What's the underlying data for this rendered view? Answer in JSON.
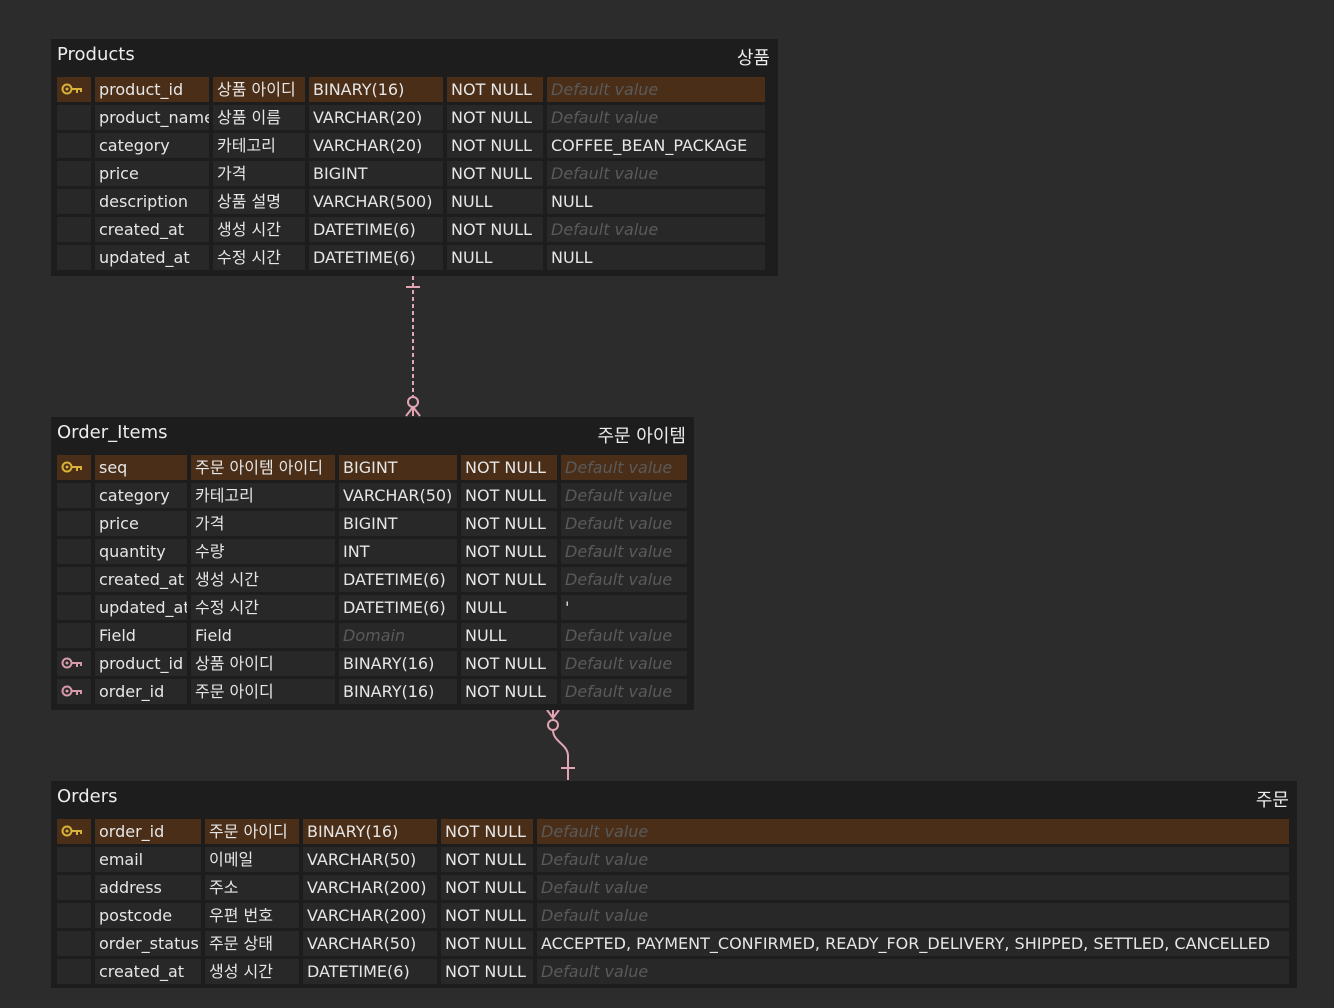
{
  "colors": {
    "background": "#2c2c2c",
    "table_bg": "#1d1d1d",
    "cell_bg": "#282828",
    "pk_row_bg": "#4a2e18",
    "pk_key": "#d9b23a",
    "fk_key": "#d89aa8",
    "relation_line": "#e3a5b4"
  },
  "placeholders": {
    "default_value": "Default value",
    "domain": "Domain"
  },
  "tables": {
    "products": {
      "title": "Products",
      "korean_name": "상품",
      "rows": [
        {
          "key": "pk",
          "name": "product_id",
          "comment": "상품 아이디",
          "type": "BINARY(16)",
          "nullable": "NOT NULL",
          "default": ""
        },
        {
          "key": "",
          "name": "product_name",
          "comment": "상품 이름",
          "type": "VARCHAR(20)",
          "nullable": "NOT NULL",
          "default": ""
        },
        {
          "key": "",
          "name": "category",
          "comment": "카테고리",
          "type": "VARCHAR(20)",
          "nullable": "NOT NULL",
          "default": "COFFEE_BEAN_PACKAGE"
        },
        {
          "key": "",
          "name": "price",
          "comment": "가격",
          "type": "BIGINT",
          "nullable": "NOT NULL",
          "default": ""
        },
        {
          "key": "",
          "name": "description",
          "comment": "상품 설명",
          "type": "VARCHAR(500)",
          "nullable": "NULL",
          "default": "NULL"
        },
        {
          "key": "",
          "name": "created_at",
          "comment": "생성 시간",
          "type": "DATETIME(6)",
          "nullable": "NOT NULL",
          "default": ""
        },
        {
          "key": "",
          "name": "updated_at",
          "comment": "수정 시간",
          "type": "DATETIME(6)",
          "nullable": "NULL",
          "default": "NULL"
        }
      ]
    },
    "order_items": {
      "title": "Order_Items",
      "korean_name": "주문 아이템",
      "rows": [
        {
          "key": "pk",
          "name": "seq",
          "comment": "주문 아이템 아이디",
          "type": "BIGINT",
          "nullable": "NOT NULL",
          "default": ""
        },
        {
          "key": "",
          "name": "category",
          "comment": "카테고리",
          "type": "VARCHAR(50)",
          "nullable": "NOT NULL",
          "default": ""
        },
        {
          "key": "",
          "name": "price",
          "comment": "가격",
          "type": "BIGINT",
          "nullable": "NOT NULL",
          "default": ""
        },
        {
          "key": "",
          "name": "quantity",
          "comment": "수량",
          "type": "INT",
          "nullable": "NOT NULL",
          "default": ""
        },
        {
          "key": "",
          "name": "created_at",
          "comment": "생성 시간",
          "type": "DATETIME(6)",
          "nullable": "NOT NULL",
          "default": ""
        },
        {
          "key": "",
          "name": "updated_at",
          "comment": "수정 시간",
          "type": "DATETIME(6)",
          "nullable": "NULL",
          "default": "'"
        },
        {
          "key": "",
          "name": "Field",
          "comment": "Field",
          "type": "",
          "nullable": "NULL",
          "default": ""
        },
        {
          "key": "fk",
          "name": "product_id",
          "comment": "상품 아이디",
          "type": "BINARY(16)",
          "nullable": "NOT NULL",
          "default": ""
        },
        {
          "key": "fk",
          "name": "order_id",
          "comment": "주문 아이디",
          "type": "BINARY(16)",
          "nullable": "NOT NULL",
          "default": ""
        }
      ]
    },
    "orders": {
      "title": "Orders",
      "korean_name": "주문",
      "rows": [
        {
          "key": "pk",
          "name": "order_id",
          "comment": "주문 아이디",
          "type": "BINARY(16)",
          "nullable": "NOT NULL",
          "default": ""
        },
        {
          "key": "",
          "name": "email",
          "comment": "이메일",
          "type": "VARCHAR(50)",
          "nullable": "NOT NULL",
          "default": ""
        },
        {
          "key": "",
          "name": "address",
          "comment": "주소",
          "type": "VARCHAR(200)",
          "nullable": "NOT NULL",
          "default": ""
        },
        {
          "key": "",
          "name": "postcode",
          "comment": "우편 번호",
          "type": "VARCHAR(200)",
          "nullable": "NOT NULL",
          "default": ""
        },
        {
          "key": "",
          "name": "order_status",
          "comment": "주문 상태",
          "type": "VARCHAR(50)",
          "nullable": "NOT NULL",
          "default": "ACCEPTED, PAYMENT_CONFIRMED, READY_FOR_DELIVERY, SHIPPED, SETTLED, CANCELLED"
        },
        {
          "key": "",
          "name": "created_at",
          "comment": "생성 시간",
          "type": "DATETIME(6)",
          "nullable": "NOT NULL",
          "default": ""
        }
      ]
    }
  },
  "relations": [
    {
      "from": "products",
      "to": "order_items",
      "from_cardinality": "one",
      "to_cardinality": "zero-or-many"
    },
    {
      "from": "orders",
      "to": "order_items",
      "from_cardinality": "one",
      "to_cardinality": "zero-or-many"
    }
  ]
}
